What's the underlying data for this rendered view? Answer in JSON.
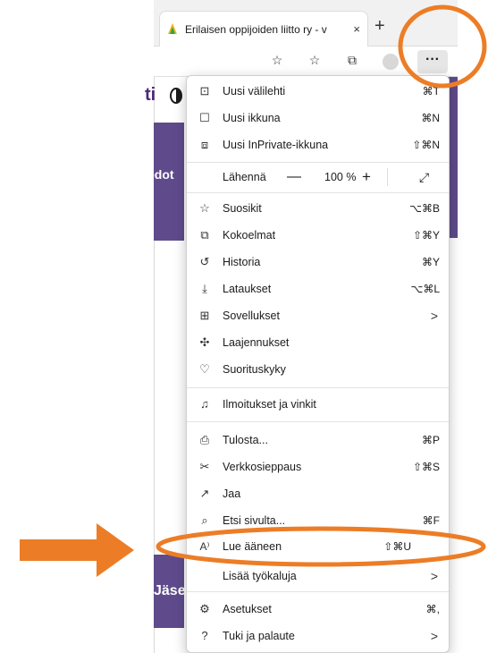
{
  "tab": {
    "title": "Erilaisen oppijoiden liitto ry - v",
    "close": "×",
    "new_tab": "+"
  },
  "toolbar": {
    "more": "···"
  },
  "page": {
    "ti_text": "ti",
    "purple_text_1": "edot",
    "purple_text_2": "Jäsen"
  },
  "menu": {
    "items": [
      {
        "label": "Uusi välilehti",
        "shortcut": "⌘T",
        "icon": "new-tab-icon"
      },
      {
        "label": "Uusi ikkuna",
        "shortcut": "⌘N",
        "icon": "window-icon"
      },
      {
        "label": "Uusi InPrivate-ikkuna",
        "shortcut": "⇧⌘N",
        "icon": "inprivate-icon"
      }
    ],
    "zoom": {
      "label": "Lähennä",
      "minus": "—",
      "value": "100 %",
      "plus": "+",
      "fullscreen": "⤢"
    },
    "items2": [
      {
        "label": "Suosikit",
        "shortcut": "⌥⌘B",
        "icon": "favorites-icon"
      },
      {
        "label": "Kokoelmat",
        "shortcut": "⇧⌘Y",
        "icon": "collections-icon"
      },
      {
        "label": "Historia",
        "shortcut": "⌘Y",
        "icon": "history-icon"
      },
      {
        "label": "Lataukset",
        "shortcut": "⌥⌘L",
        "icon": "downloads-icon"
      },
      {
        "label": "Sovellukset",
        "shortcut": "",
        "chevron": ">",
        "icon": "apps-icon"
      },
      {
        "label": "Laajennukset",
        "shortcut": "",
        "icon": "extensions-icon"
      },
      {
        "label": "Suorituskyky",
        "shortcut": "",
        "icon": "performance-icon"
      }
    ],
    "items3": [
      {
        "label": "Ilmoitukset ja vinkit",
        "icon": "bell-icon"
      }
    ],
    "items4": [
      {
        "label": "Tulosta...",
        "shortcut": "⌘P",
        "icon": "print-icon"
      },
      {
        "label": "Verkkosieppaus",
        "shortcut": "⇧⌘S",
        "icon": "web-capture-icon"
      },
      {
        "label": "Jaa",
        "shortcut": "",
        "icon": "share-icon"
      },
      {
        "label": "Etsi sivulta...",
        "shortcut": "⌘F",
        "icon": "find-icon"
      },
      {
        "label": "Lue ääneen",
        "shortcut": "⇧⌘U",
        "icon": "read-aloud-icon"
      },
      {
        "label": "Lisää työkaluja",
        "shortcut": "",
        "chevron": ">",
        "icon": ""
      }
    ],
    "items5": [
      {
        "label": "Asetukset",
        "shortcut": "⌘,",
        "icon": "settings-icon"
      },
      {
        "label": "Tuki ja palaute",
        "shortcut": "",
        "chevron": ">",
        "icon": "help-icon"
      }
    ]
  },
  "colors": {
    "annotation": "#ec7d26",
    "purple": "#5f4b8b"
  }
}
